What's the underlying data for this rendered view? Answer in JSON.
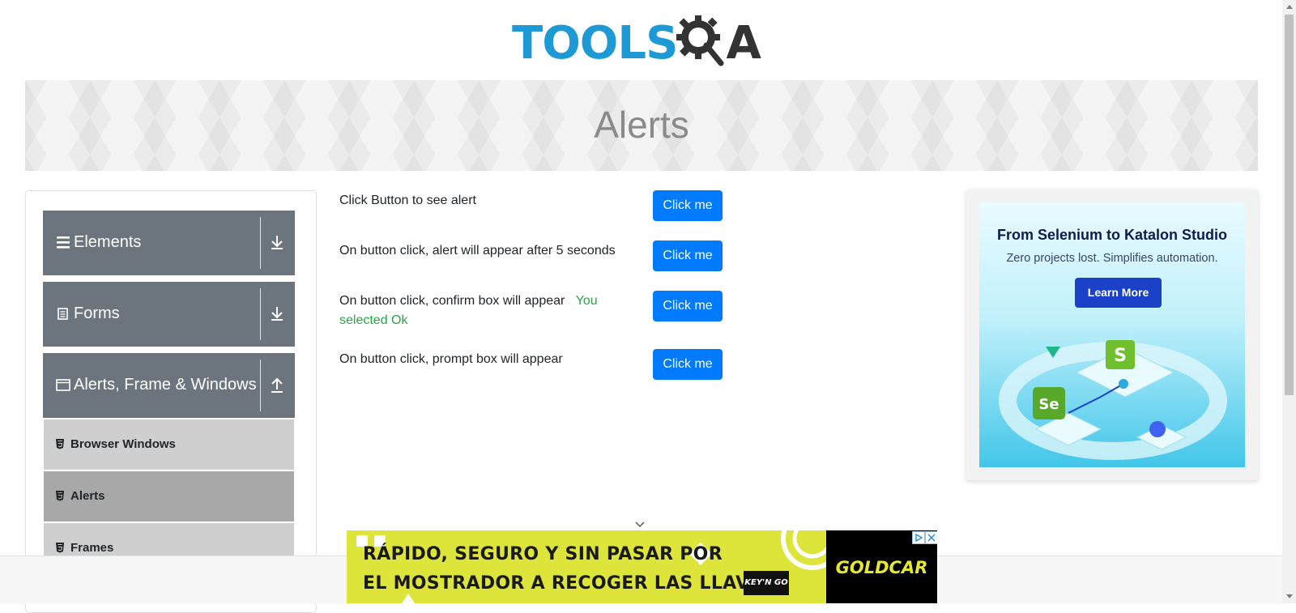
{
  "logo": {
    "part1": "TOOLS",
    "part2": "QA"
  },
  "page": {
    "title": "Alerts"
  },
  "sidebar": {
    "groups": [
      {
        "label": "Elements",
        "icon": "hamburger-icon",
        "expanded": false
      },
      {
        "label": "Forms",
        "icon": "document-icon",
        "expanded": false
      },
      {
        "label": "Alerts, Frame & Windows",
        "icon": "window-icon",
        "expanded": true
      }
    ],
    "items": [
      {
        "label": "Browser Windows",
        "active": false
      },
      {
        "label": "Alerts",
        "active": true
      },
      {
        "label": "Frames",
        "active": false
      }
    ]
  },
  "main": {
    "rows": [
      {
        "text": "Click Button to see alert",
        "button": "Click me"
      },
      {
        "text": "On button click, alert will appear after 5 seconds",
        "button": "Click me"
      },
      {
        "text": "On button click, confirm box will appear",
        "result": "You selected Ok",
        "button": "Click me"
      },
      {
        "text": "On button click, prompt box will appear",
        "button": "Click me"
      }
    ]
  },
  "ad_right": {
    "title": "From Selenium to Katalon Studio",
    "subtitle": "Zero projects lost. Simplifies automation.",
    "button": "Learn More",
    "badge_s": "S",
    "badge_se": "Se"
  },
  "ad_bottom": {
    "line1": "RÁPIDO, SEGURO Y SIN PASAR POR",
    "line2": "EL MOSTRADOR A RECOGER LAS LLAVES",
    "badge": "KEY'N GO",
    "brand": "GOLDCAR"
  },
  "colors": {
    "primary_button": "#007bff",
    "sidebar_group": "#6c757d",
    "success_text": "#28a745",
    "logo_blue": "#1d9ad6"
  }
}
